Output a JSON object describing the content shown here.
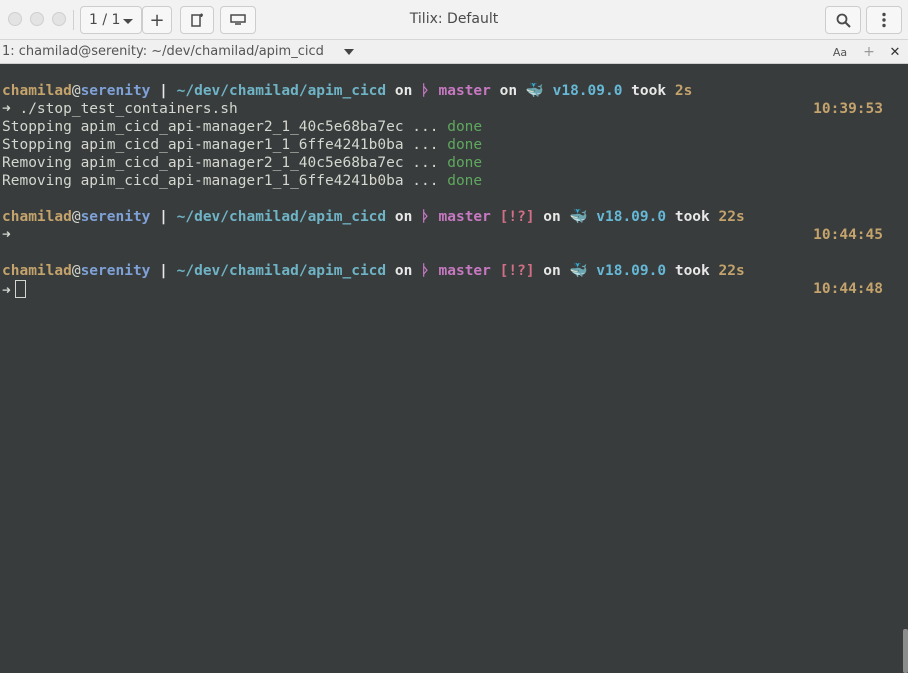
{
  "window": {
    "title": "Tilix: Default"
  },
  "session": {
    "indicator": "1 / 1"
  },
  "terminal": {
    "title": "1: chamilad@serenity: ~/dev/chamilad/apim_cicd",
    "prompt": {
      "user": "chamilad",
      "at": "@",
      "host": "serenity",
      "pipe": " | ",
      "path": "~/dev/chamilad/apim_cicd",
      "on": " on ",
      "git_icon": "ᚦ",
      "branch": "master",
      "status": "[!?]",
      "docker_icon": "🐳",
      "docker_version": "v18.09.0",
      "took": " took ",
      "arrow": "➜"
    },
    "blocks": [
      {
        "took": "2s",
        "time": "10:39:53",
        "command": " ./stop_test_containers.sh"
      },
      {
        "took": "22s",
        "time": "10:44:45",
        "command": ""
      },
      {
        "took": "22s",
        "time": "10:44:48",
        "command": ""
      }
    ],
    "output": [
      {
        "text": "Stopping apim_cicd_api-manager2_1_40c5e68ba7ec ... ",
        "status": "done"
      },
      {
        "text": "Stopping apim_cicd_api-manager1_1_6ffe4241b0ba ... ",
        "status": "done"
      },
      {
        "text": "Removing apim_cicd_api-manager2_1_40c5e68ba7ec ... ",
        "status": "done"
      },
      {
        "text": "Removing apim_cicd_api-manager1_1_6ffe4241b0ba ... ",
        "status": "done"
      }
    ]
  },
  "icons": {
    "add": "+",
    "split": "split-icon",
    "sidebar": "sidebar-icon",
    "search": "search-icon",
    "menu": "kebab-menu-icon",
    "text_size": "Aa",
    "plus_small": "+",
    "close": "✕"
  }
}
